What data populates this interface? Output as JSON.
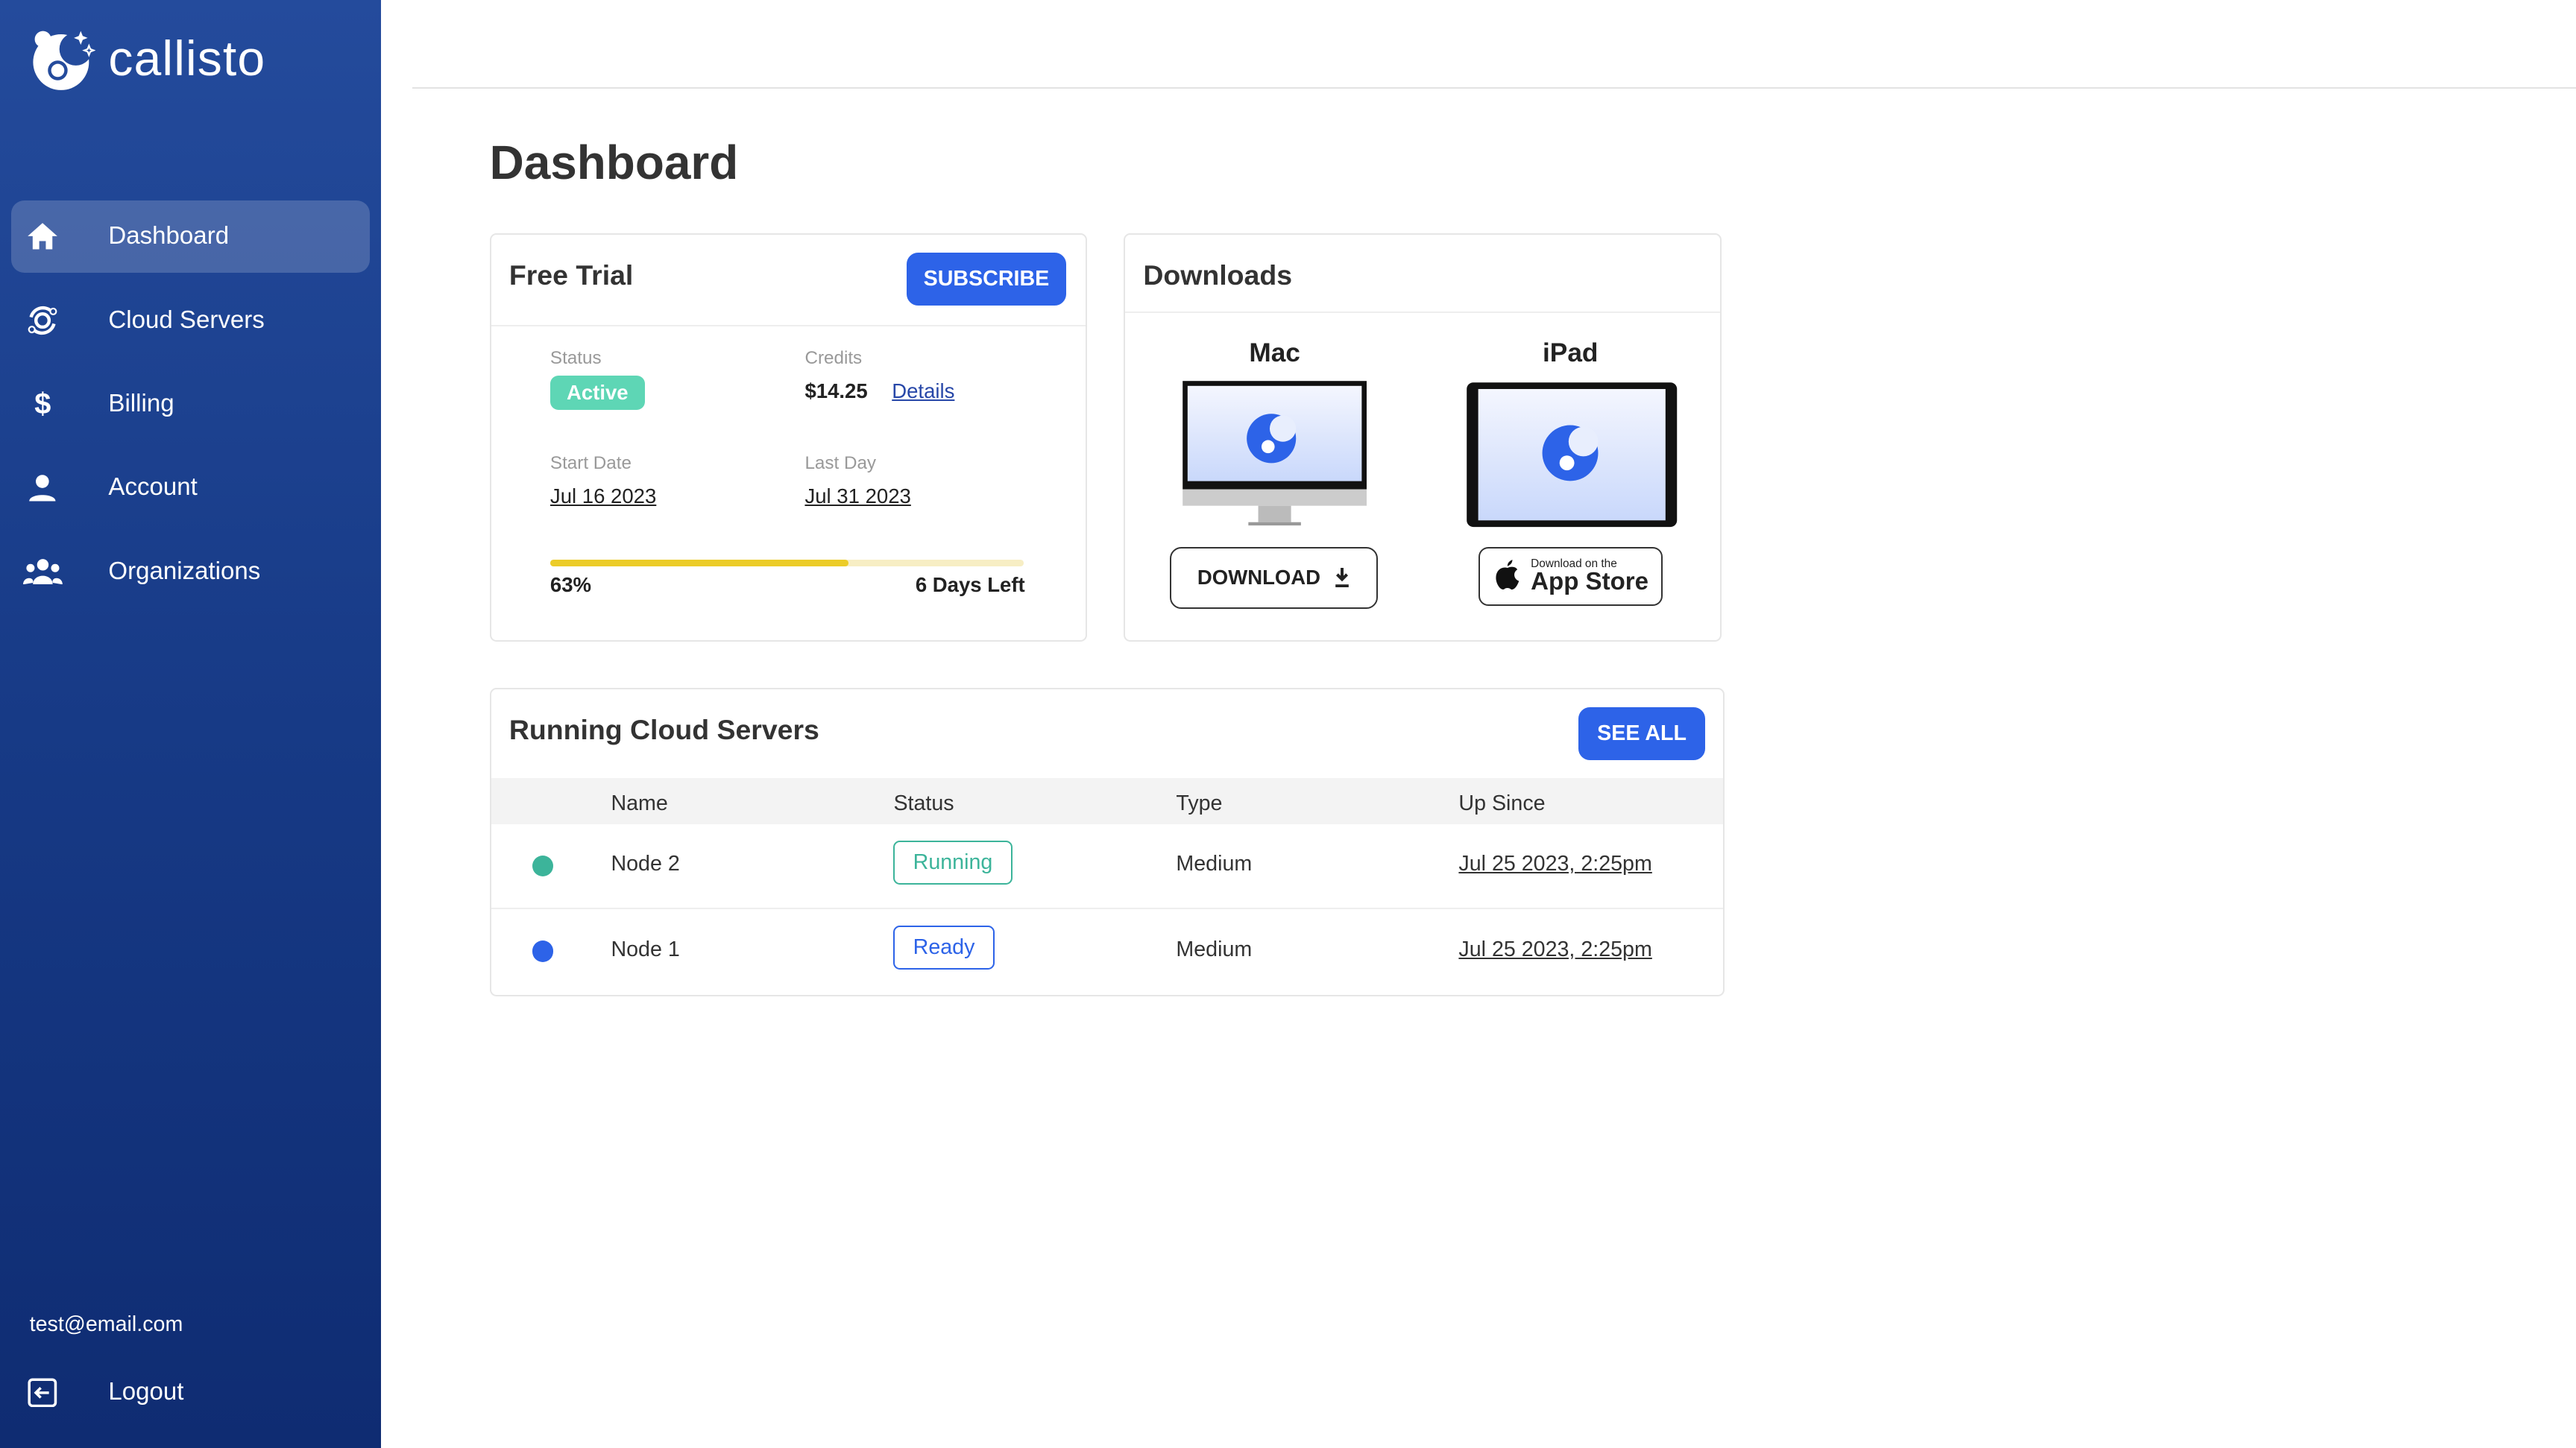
{
  "app": {
    "name": "callisto"
  },
  "sidebar": {
    "items": [
      {
        "label": "Dashboard",
        "icon": "home-icon"
      },
      {
        "label": "Cloud Servers",
        "icon": "cloud-servers-icon"
      },
      {
        "label": "Billing",
        "icon": "dollar-icon"
      },
      {
        "label": "Account",
        "icon": "user-icon"
      },
      {
        "label": "Organizations",
        "icon": "users-icon"
      }
    ],
    "email": "test@email.com",
    "logout": "Logout"
  },
  "page": {
    "title": "Dashboard"
  },
  "free_trial": {
    "title": "Free Trial",
    "subscribe": "SUBSCRIBE",
    "status_label": "Status",
    "status": "Active",
    "credits_label": "Credits",
    "credits": "$14.25",
    "details": "Details",
    "start_label": "Start Date",
    "start": "Jul 16 2023",
    "last_label": "Last Day",
    "last": "Jul 31 2023",
    "progress_percent": 63,
    "progress_text": "63%",
    "days_left": "6 Days Left"
  },
  "downloads": {
    "title": "Downloads",
    "mac": "Mac",
    "ipad": "iPad",
    "download": "DOWNLOAD",
    "appstore_small": "Download on the",
    "appstore_big": "App Store"
  },
  "servers": {
    "title": "Running Cloud Servers",
    "see_all": "SEE ALL",
    "columns": [
      "Name",
      "Status",
      "Type",
      "Up Since"
    ],
    "rows": [
      {
        "name": "Node 2",
        "status": "Running",
        "type": "Medium",
        "up_since": "Jul 25 2023, 2:25pm",
        "dot": "#3cb49a"
      },
      {
        "name": "Node 1",
        "status": "Ready",
        "type": "Medium",
        "up_since": "Jul 25 2023, 2:25pm",
        "dot": "#2d63e8"
      }
    ]
  },
  "colors": {
    "accent": "#2d63e8",
    "active": "#5ed6b5",
    "running": "#3cb49a",
    "progress": "#eccc28"
  }
}
